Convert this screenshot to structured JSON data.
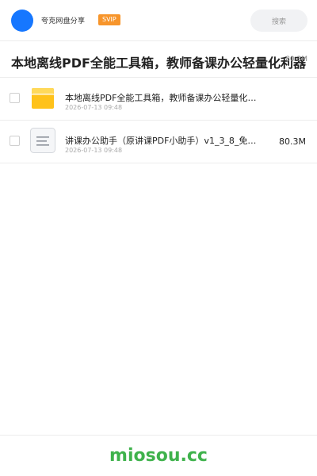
{
  "header": {
    "app_name": "夸克网盘分享",
    "badge": "SVIP",
    "search_placeholder": "搜索"
  },
  "title": {
    "text": "本地离线PDF全能工具箱，教师备课办公轻量化利器",
    "size": "80.3M"
  },
  "files": [
    {
      "name": "本地离线PDF全能工具箱，教师备课办公轻量化利器",
      "date": "2026-07-13 09:48",
      "size": "",
      "icon": "folder-icon"
    },
    {
      "name": "讲课办公助手（原讲课PDF小助手）v1_3_8_免…",
      "date": "2026-07-13 09:48",
      "size": "80.3M",
      "icon": "document-icon"
    }
  ],
  "footer": {
    "brand": "miosou.cc"
  },
  "colors": {
    "accent": "#1677ff",
    "badge": "#f7952b",
    "folder": "#ffc21a",
    "brand": "#3fb24c"
  }
}
